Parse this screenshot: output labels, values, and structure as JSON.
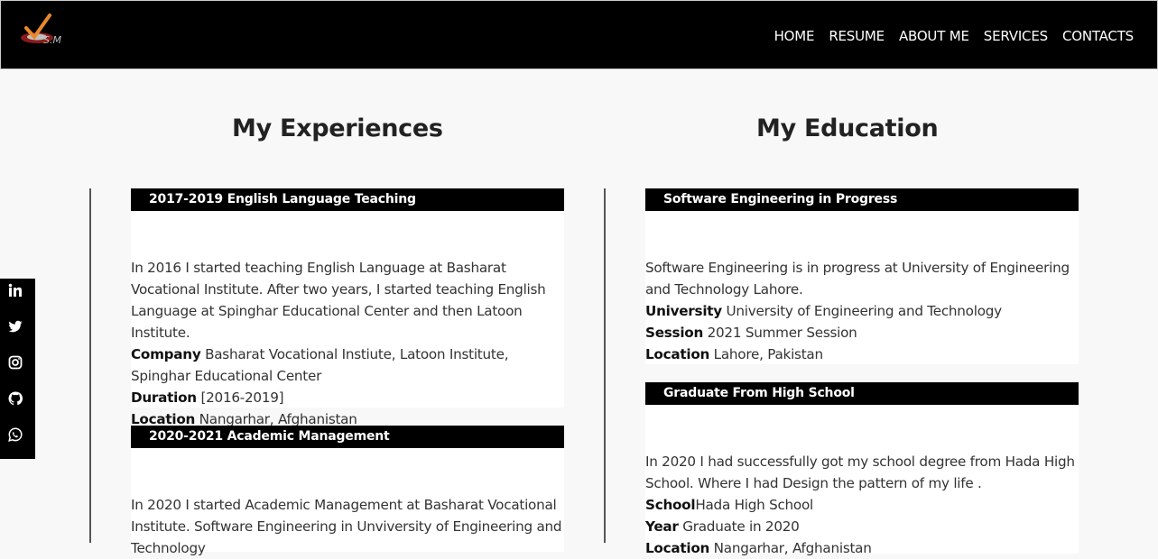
{
  "logo": {
    "text": "S.M"
  },
  "nav": [
    "HOME",
    "RESUME",
    "ABOUT ME",
    "SERVICES",
    "CONTACTS"
  ],
  "experiences": {
    "title": "My Experiences",
    "items": [
      {
        "heading": "2017-2019 English Language Teaching",
        "desc": "In 2016 I started teaching English Language at Basharat Vocational Institute. After two years, I started teaching English Language at Spinghar Educational Center and then Latoon Institute.",
        "company_label": "Company",
        "company": " Basharat Vocational Instiute, Latoon Institute, Spinghar Educational Center",
        "duration_label": "Duration",
        "duration": " [2016-2019]",
        "location_label": "Location",
        "location": " Nangarhar, Afghanistan"
      },
      {
        "heading": "2020-2021 Academic Management",
        "desc": "In 2020 I started Academic Management at Basharat Vocational Institute. Software Engineering in Unviversity of Engineering and Technology"
      }
    ]
  },
  "education": {
    "title": "My Education",
    "items": [
      {
        "heading": "Software Engineering in Progress",
        "desc": "Software Engineering is in progress at University of Engineering and Technology Lahore.",
        "university_label": "University",
        "university": " University of Engineering and Technology",
        "session_label": "Session",
        "session": " 2021 Summer Session",
        "location_label": "Location",
        "location": " Lahore, Pakistan"
      },
      {
        "heading": "Graduate From High School",
        "desc": "In 2020 I had successfully got my school degree from Hada High School. Where I had Design the pattern of my life .",
        "school_label": "School",
        "school": "Hada High School",
        "year_label": "Year",
        "year": " Graduate in 2020",
        "location_label": "Location",
        "location": " Nangarhar, Afghanistan"
      }
    ]
  },
  "social": [
    "linkedin-icon",
    "twitter-icon",
    "instagram-icon",
    "github-icon",
    "whatsapp-icon"
  ]
}
